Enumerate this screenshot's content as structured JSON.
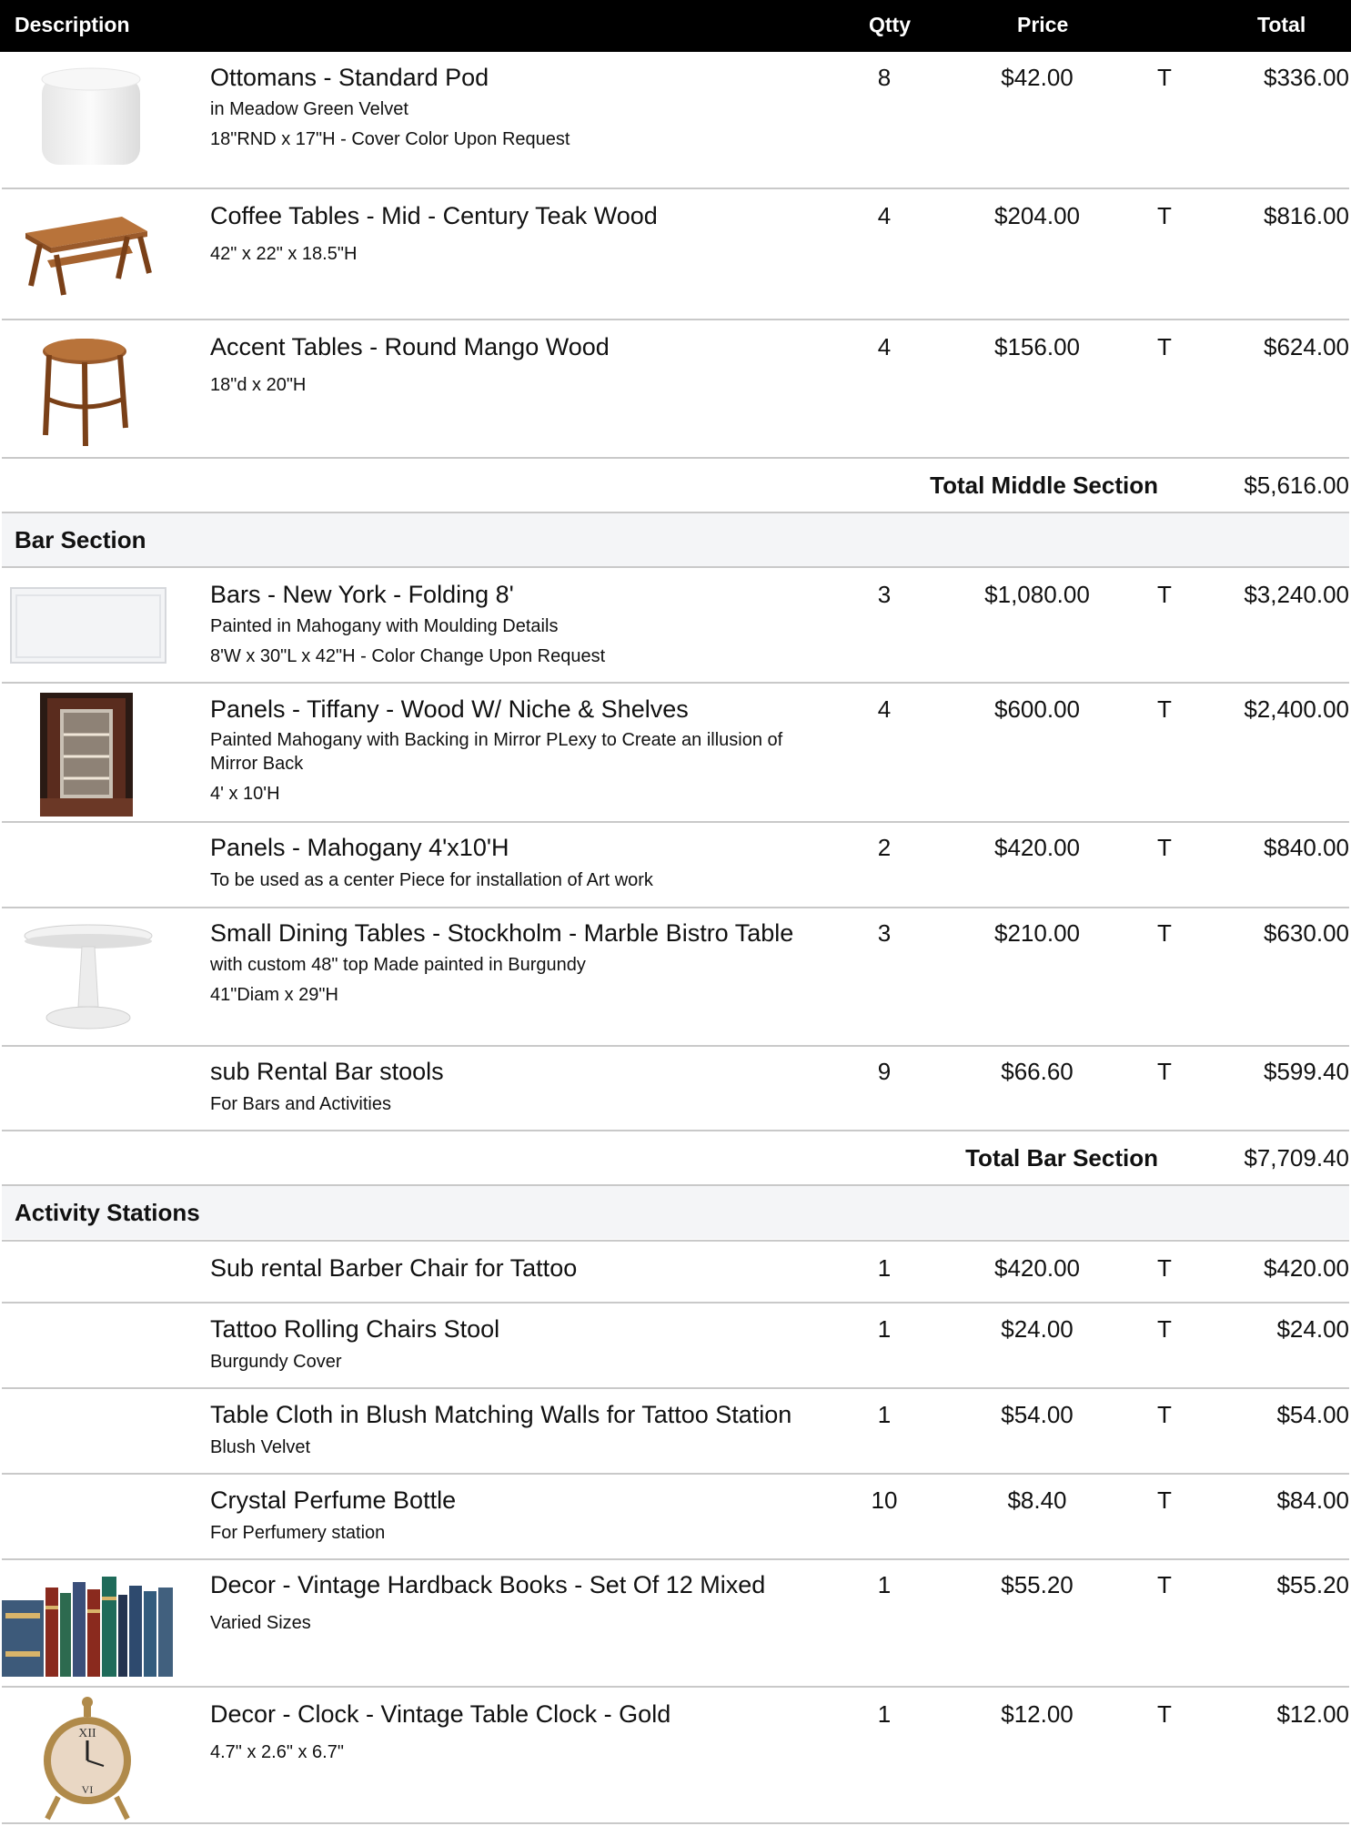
{
  "header": {
    "description": "Description",
    "qty": "Qtty",
    "price": "Price",
    "total": "Total"
  },
  "items": [
    {
      "title": "Ottomans - Standard Pod",
      "lines": [
        "in Meadow Green Velvet",
        "18\"RND x 17\"H - Cover Color Upon Request"
      ],
      "qty": "8",
      "price": "$42.00",
      "tax": "T",
      "total": "$336.00",
      "icon": "ottoman-image"
    },
    {
      "title": "Coffee Tables - Mid - Century Teak Wood",
      "lines": [
        "42\" x 22\" x 18.5\"H"
      ],
      "qty": "4",
      "price": "$204.00",
      "tax": "T",
      "total": "$816.00",
      "icon": "coffee-table-image"
    },
    {
      "title": "Accent Tables - Round Mango Wood",
      "lines": [
        "18\"d x 20\"H"
      ],
      "qty": "4",
      "price": "$156.00",
      "tax": "T",
      "total": "$624.00",
      "icon": "accent-table-image"
    },
    {
      "title": "Bars - New York -  Folding 8'",
      "lines": [
        "Painted in Mahogany with   Moulding Details",
        "8'W x 30\"L x 42\"H - Color Change Upon Request"
      ],
      "qty": "3",
      "price": "$1,080.00",
      "tax": "T",
      "total": "$3,240.00",
      "icon": "bar-image"
    },
    {
      "title": "Panels - Tiffany - Wood W/ Niche & Shelves",
      "lines": [
        "Painted Mahogany with Backing in Mirror PLexy to Create an illusion of Mirror Back",
        "4' x 10'H"
      ],
      "qty": "4",
      "price": "$600.00",
      "tax": "T",
      "total": "$2,400.00",
      "icon": "panel-image"
    },
    {
      "title": "Panels - Mahogany 4'x10'H",
      "lines": [
        "To be used as a center Piece for installation of  Art work"
      ],
      "qty": "2",
      "price": "$420.00",
      "tax": "T",
      "total": "$840.00",
      "icon": ""
    },
    {
      "title": "Small Dining Tables - Stockholm - Marble Bistro Table",
      "lines": [
        "with custom 48\" top Made painted in Burgundy",
        "41\"Diam x 29\"H"
      ],
      "qty": "3",
      "price": "$210.00",
      "tax": "T",
      "total": "$630.00",
      "icon": "bistro-table-image"
    },
    {
      "title": "sub Rental Bar stools",
      "lines": [
        "For Bars and Activities"
      ],
      "qty": "9",
      "price": "$66.60",
      "tax": "T",
      "total": "$599.40",
      "icon": ""
    },
    {
      "title": "Sub rental Barber Chair for Tattoo",
      "lines": [],
      "qty": "1",
      "price": "$420.00",
      "tax": "T",
      "total": "$420.00",
      "icon": ""
    },
    {
      "title": "Tattoo Rolling Chairs Stool",
      "lines": [
        "Burgundy Cover"
      ],
      "qty": "1",
      "price": "$24.00",
      "tax": "T",
      "total": "$24.00",
      "icon": ""
    },
    {
      "title": "Table Cloth in Blush Matching Walls for Tattoo Station",
      "lines": [
        "Blush Velvet"
      ],
      "qty": "1",
      "price": "$54.00",
      "tax": "T",
      "total": "$54.00",
      "icon": ""
    },
    {
      "title": "Crystal Perfume Bottle",
      "lines": [
        "For Perfumery station"
      ],
      "qty": "10",
      "price": "$8.40",
      "tax": "T",
      "total": "$84.00",
      "icon": ""
    },
    {
      "title": "Decor - Vintage Hardback Books - Set Of 12 Mixed",
      "lines": [
        "Varied Sizes"
      ],
      "qty": "1",
      "price": "$55.20",
      "tax": "T",
      "total": "$55.20",
      "icon": "books-image"
    },
    {
      "title": "Decor - Clock - Vintage Table Clock - Gold",
      "lines": [
        "4.7\" x 2.6\" x 6.7\""
      ],
      "qty": "1",
      "price": "$12.00",
      "tax": "T",
      "total": "$12.00",
      "icon": "clock-image"
    }
  ],
  "subtotals": {
    "middle": {
      "label": "Total Middle Section",
      "value": "$5,616.00"
    },
    "bar": {
      "label": "Total Bar Section",
      "value": "$7,709.40"
    }
  },
  "sections": {
    "bar": "Bar Section",
    "activity": "Activity Stations"
  }
}
